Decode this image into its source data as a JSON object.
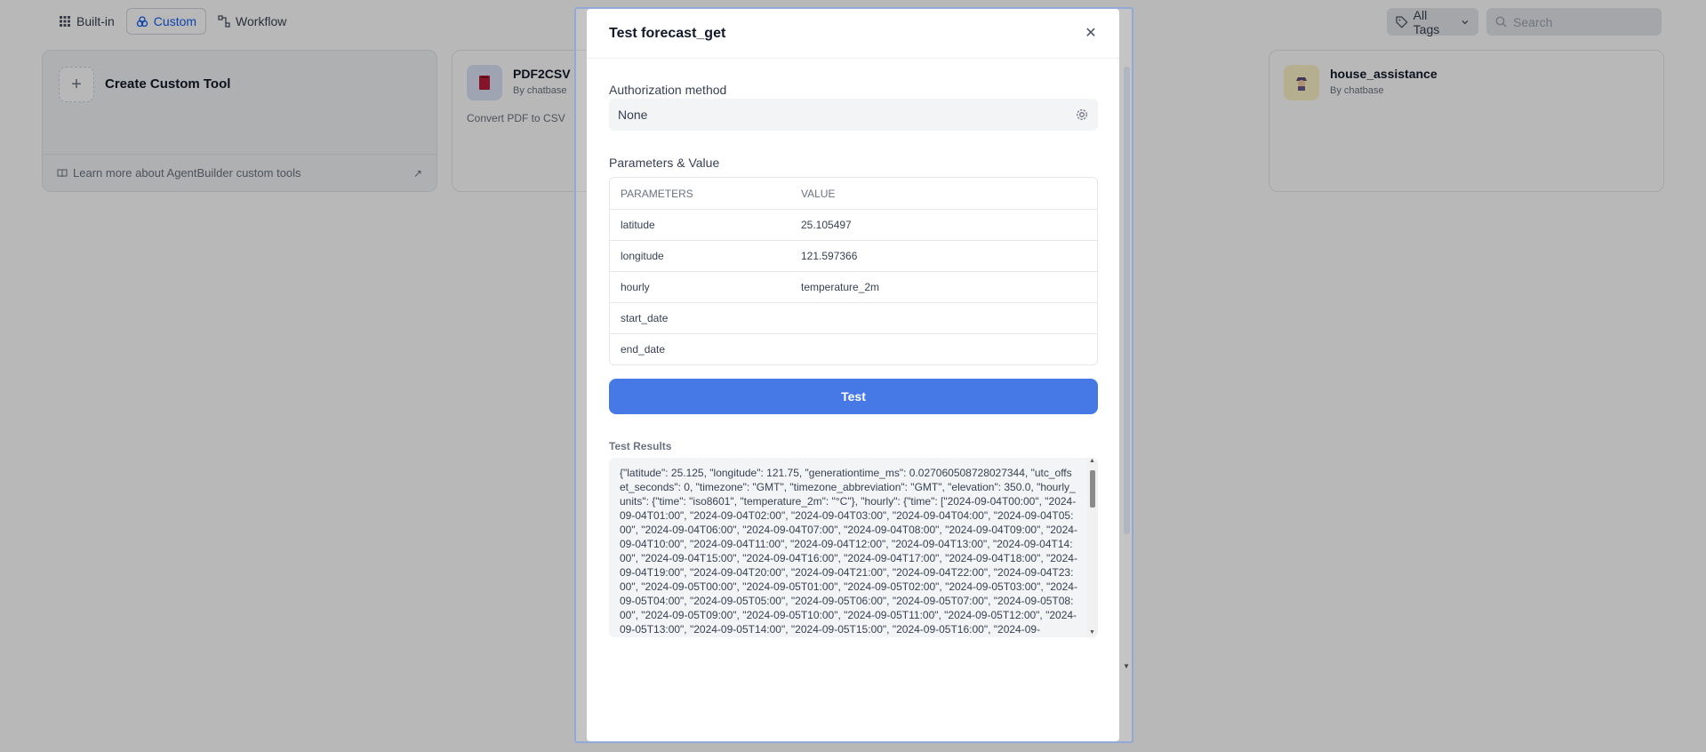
{
  "nav": {
    "tabs": [
      {
        "label": "Built-in",
        "icon": "grid-icon"
      },
      {
        "label": "Custom",
        "icon": "custom-tool-icon"
      },
      {
        "label": "Workflow",
        "icon": "workflow-icon"
      }
    ],
    "tags_label": "All Tags",
    "search_placeholder": "Search"
  },
  "cards": {
    "create": {
      "title": "Create Custom Tool",
      "footer": "Learn more about AgentBuilder custom tools"
    },
    "pdf2csv": {
      "name": "PDF2CSV",
      "author": "By chatbase",
      "description": "Convert PDF to CSV"
    },
    "house": {
      "name": "house_assistance",
      "author": "By chatbase"
    }
  },
  "modal": {
    "title": "Test forecast_get",
    "auth_label": "Authorization method",
    "auth_value": "None",
    "params_label": "Parameters & Value",
    "params_header": {
      "name": "PARAMETERS",
      "value": "VALUE"
    },
    "params": [
      {
        "name": "latitude",
        "value": "25.105497"
      },
      {
        "name": "longitude",
        "value": "121.597366"
      },
      {
        "name": "hourly",
        "value": "temperature_2m"
      },
      {
        "name": "start_date",
        "value": ""
      },
      {
        "name": "end_date",
        "value": ""
      }
    ],
    "test_button": "Test",
    "results_label": "Test Results",
    "results_text": "{\"latitude\": 25.125, \"longitude\": 121.75, \"generationtime_ms\": 0.027060508728027344, \"utc_offset_seconds\": 0, \"timezone\": \"GMT\", \"timezone_abbreviation\": \"GMT\", \"elevation\": 350.0, \"hourly_units\": {\"time\": \"iso8601\", \"temperature_2m\": \"°C\"}, \"hourly\": {\"time\": [\"2024-09-04T00:00\", \"2024-09-04T01:00\", \"2024-09-04T02:00\", \"2024-09-04T03:00\", \"2024-09-04T04:00\", \"2024-09-04T05:00\", \"2024-09-04T06:00\", \"2024-09-04T07:00\", \"2024-09-04T08:00\", \"2024-09-04T09:00\", \"2024-09-04T10:00\", \"2024-09-04T11:00\", \"2024-09-04T12:00\", \"2024-09-04T13:00\", \"2024-09-04T14:00\", \"2024-09-04T15:00\", \"2024-09-04T16:00\", \"2024-09-04T17:00\", \"2024-09-04T18:00\", \"2024-09-04T19:00\", \"2024-09-04T20:00\", \"2024-09-04T21:00\", \"2024-09-04T22:00\", \"2024-09-04T23:00\", \"2024-09-05T00:00\", \"2024-09-05T01:00\", \"2024-09-05T02:00\", \"2024-09-05T03:00\", \"2024-09-05T04:00\", \"2024-09-05T05:00\", \"2024-09-05T06:00\", \"2024-09-05T07:00\", \"2024-09-05T08:00\", \"2024-09-05T09:00\", \"2024-09-05T10:00\", \"2024-09-05T11:00\", \"2024-09-05T12:00\", \"2024-09-05T13:00\", \"2024-09-05T14:00\", \"2024-09-05T15:00\", \"2024-09-05T16:00\", \"2024-09-"
  },
  "colors": {
    "primary": "#4779e6",
    "active_tab": "#155eef",
    "overlay": "rgba(0,0,0,0.28)"
  }
}
